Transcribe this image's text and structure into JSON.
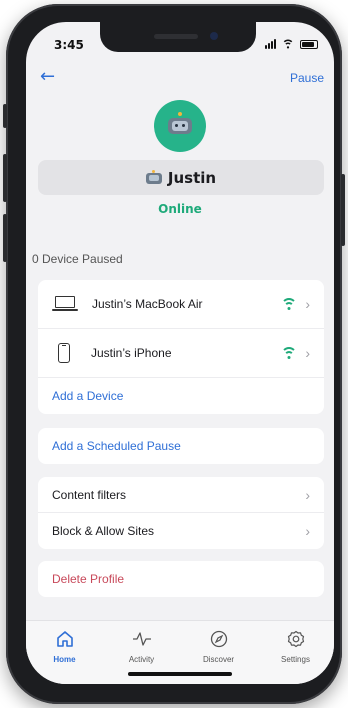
{
  "status_bar": {
    "time": "3:45"
  },
  "nav": {
    "back_icon": "arrow-left-icon",
    "pause_label": "Pause"
  },
  "profile": {
    "name": "Justin",
    "status": "Online",
    "avatar_icon": "robot-icon",
    "avatar_color": "#26b38a"
  },
  "devices_section": {
    "paused_label": "0 Device Paused",
    "devices": [
      {
        "name": "Justin’s MacBook Air",
        "icon": "laptop-icon",
        "status_icon": "wifi-icon"
      },
      {
        "name": "Justin’s iPhone",
        "icon": "phone-icon",
        "status_icon": "wifi-icon"
      }
    ],
    "add_device_label": "Add a Device"
  },
  "scheduled": {
    "add_label": "Add a Scheduled Pause"
  },
  "filters": {
    "content_filters_label": "Content filters",
    "block_allow_label": "Block & Allow Sites"
  },
  "danger": {
    "delete_label": "Delete Profile"
  },
  "tabs": [
    {
      "label": "Home",
      "icon": "home-icon",
      "active": true
    },
    {
      "label": "Activity",
      "icon": "activity-icon",
      "active": false
    },
    {
      "label": "Discover",
      "icon": "compass-icon",
      "active": false
    },
    {
      "label": "Settings",
      "icon": "gear-icon",
      "active": false
    }
  ],
  "colors": {
    "accent": "#2f6fd6",
    "online": "#1faa7a",
    "danger": "#c8495a"
  }
}
